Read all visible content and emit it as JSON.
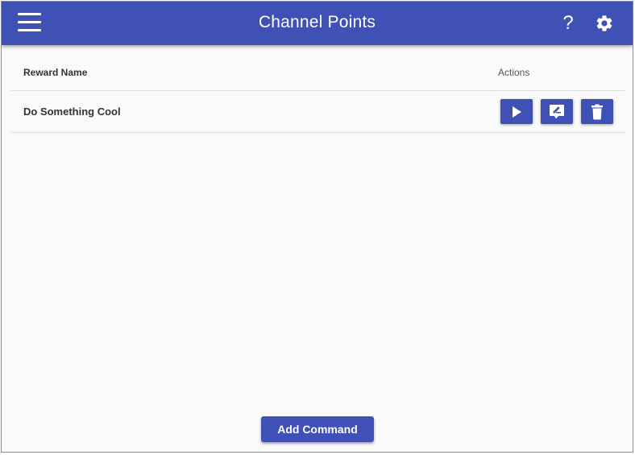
{
  "app_bar": {
    "title": "Channel Points",
    "help_label": "?",
    "icons": {
      "menu": "hamburger-menu-icon",
      "settings": "gear-icon"
    },
    "color": "#3f51b5"
  },
  "table": {
    "headers": {
      "reward_name": "Reward Name",
      "actions": "Actions"
    },
    "rows": [
      {
        "name": "Do Something Cool",
        "actions": [
          "play-icon",
          "edit-comment-icon",
          "trash-icon"
        ]
      }
    ]
  },
  "footer": {
    "add_command_label": "Add Command"
  }
}
